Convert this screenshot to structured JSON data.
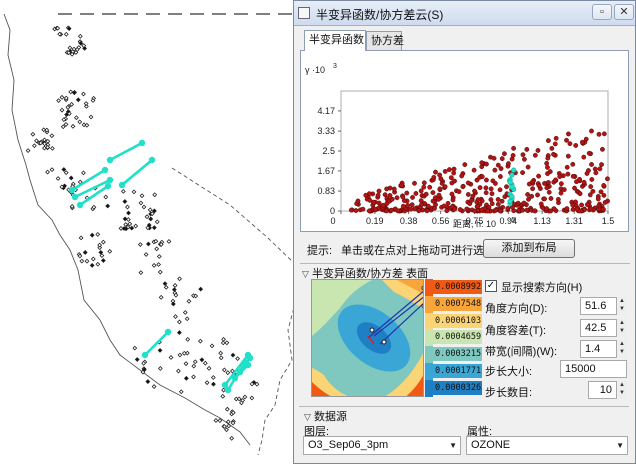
{
  "window": {
    "title": "半变异函数/协方差云(S)"
  },
  "tabs": [
    {
      "label": "半变异函数"
    },
    {
      "label": "协方差"
    }
  ],
  "chart_data": {
    "type": "scatter",
    "y_exponent_label": "γ ·10",
    "y_exponent_sup": "3",
    "yticks": [
      "0",
      "0.83",
      "1.67",
      "2.5",
      "3.33",
      "4.17"
    ],
    "xticks": [
      "0",
      "0.19",
      "0.38",
      "0.56",
      "0.75",
      "0.94",
      "1.13",
      "1.31",
      "1.5"
    ],
    "xlabel": "距离, h: 10",
    "xlabel_sup": "-5",
    "xlim": [
      0,
      1.5
    ],
    "ylim": [
      0,
      5
    ],
    "point_color": "#b01515",
    "highlight_color": "#1fe0c8",
    "highlight_x": [
      0.95,
      0.96,
      0.95,
      0.97,
      0.96,
      0.95,
      0.96,
      0.97,
      0.95,
      0.96,
      0.96,
      0.95
    ],
    "highlight_y": [
      0.3,
      0.5,
      0.7,
      0.9,
      1.1,
      1.3,
      1.5,
      1.7,
      0.4,
      0.6,
      1.0,
      1.2
    ]
  },
  "hint": {
    "label": "提示:",
    "text": "单击或在点对上拖动可进行选"
  },
  "add_to_layout_button": "添加到布局",
  "surface_section": {
    "header": "半变异函数/协方差 表面",
    "legend": [
      {
        "value": "0.0008992",
        "color": "#f05a14"
      },
      {
        "value": "0.0007548",
        "color": "#f8a63a"
      },
      {
        "value": "0.0006103",
        "color": "#fbd476"
      },
      {
        "value": "0.0004659",
        "color": "#c9e6b0"
      },
      {
        "value": "0.0003215",
        "color": "#7fc8c0"
      },
      {
        "value": "0.0001771",
        "color": "#3aa6d6"
      },
      {
        "value": "0.00003263",
        "color": "#1f7fc4"
      }
    ]
  },
  "search_direction": {
    "checkbox_label": "显示搜索方向(H)",
    "checked": true,
    "angle_label": "角度方向(D):",
    "angle_value": "51.6",
    "tolerance_label": "角度容差(T):",
    "tolerance_value": "42.5",
    "bandwidth_label": "带宽(间隔)(W):",
    "bandwidth_value": "1.4",
    "lag_size_label": "步长大小:",
    "lag_size_value": "15000",
    "lag_count_label": "步长数目:",
    "lag_count_value": "10"
  },
  "data_source": {
    "header": "数据源",
    "layer_label": "图层:",
    "layer_value": "O3_Sep06_3pm",
    "attribute_label": "属性:",
    "attribute_value": "OZONE"
  },
  "map": {
    "point_color": "#222222",
    "selected_color": "#1fe0c8"
  }
}
